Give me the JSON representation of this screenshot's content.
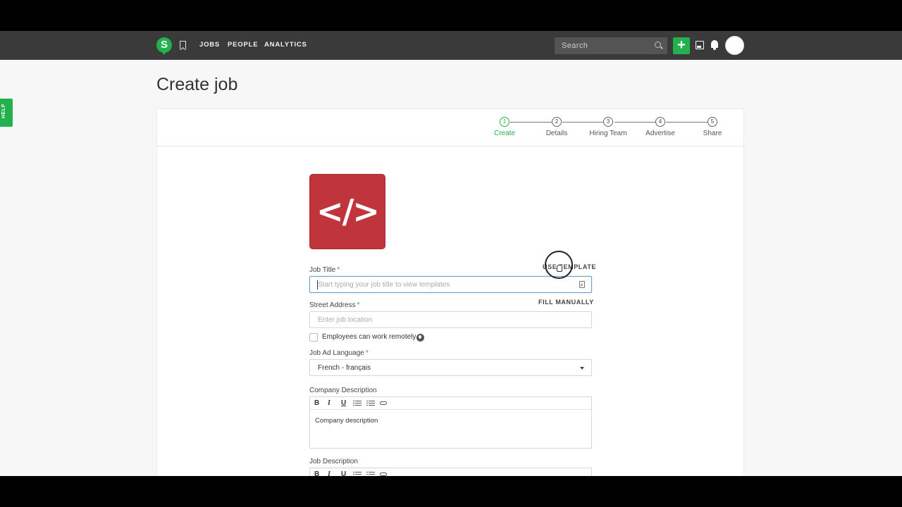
{
  "nav": {
    "logo_letter": "S",
    "links": [
      "JOBS",
      "PEOPLE",
      "ANALYTICS"
    ],
    "search_placeholder": "Search",
    "add_label": "+"
  },
  "help_tab": "HELP",
  "page_title": "Create job",
  "steps": [
    {
      "num": "1",
      "label": "Create",
      "active": true
    },
    {
      "num": "2",
      "label": "Details",
      "active": false
    },
    {
      "num": "3",
      "label": "Hiring Team",
      "active": false
    },
    {
      "num": "4",
      "label": "Advertise",
      "active": false
    },
    {
      "num": "5",
      "label": "Share",
      "active": false
    }
  ],
  "job_logo_text": "</>",
  "colors": {
    "accent": "#22b14c",
    "logo_bg": "#c0353c",
    "nav_bg": "#3a3a3a"
  },
  "form": {
    "job_title": {
      "label": "Job Title",
      "required_mark": "*",
      "placeholder": "Start typing your job title to view templates",
      "action": "USE TEMPLATE"
    },
    "street_address": {
      "label": "Street Address",
      "required_mark": "*",
      "placeholder": "Enter job location",
      "action": "FILL MANUALLY"
    },
    "remote": {
      "label": "Employees can work remotely",
      "checked": false
    },
    "language": {
      "label": "Job Ad Language",
      "required_mark": "*",
      "selected": "French - français"
    },
    "company_description": {
      "label": "Company Description",
      "toolbar": [
        "B",
        "I",
        "U"
      ],
      "content": "Company description"
    },
    "job_description": {
      "label": "Job Description",
      "toolbar": [
        "B",
        "I",
        "U"
      ]
    }
  }
}
